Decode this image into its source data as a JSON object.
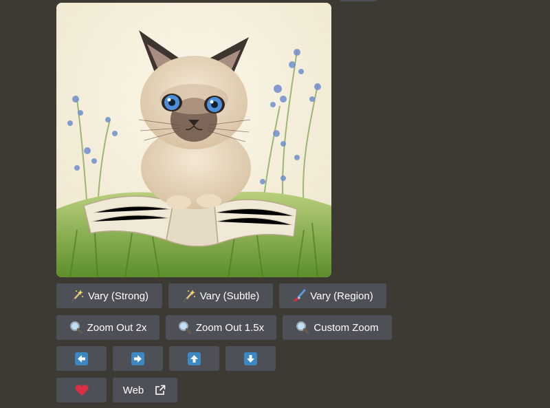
{
  "message": {
    "image_alt": "Watercolor Siamese kitten sitting on an open book in grass with blue flowers"
  },
  "buttons": {
    "row1": [
      {
        "label": "Vary (Strong)",
        "icon": "magic-wand-icon"
      },
      {
        "label": "Vary (Subtle)",
        "icon": "magic-wand-icon"
      },
      {
        "label": "Vary (Region)",
        "icon": "paintbrush-icon"
      }
    ],
    "row2": [
      {
        "label": "Zoom Out 2x",
        "icon": "magnifier-icon"
      },
      {
        "label": "Zoom Out 1.5x",
        "icon": "magnifier-icon"
      },
      {
        "label": "Custom Zoom",
        "icon": "magnifier-icon"
      }
    ],
    "row3": [
      {
        "icon": "arrow-left-icon"
      },
      {
        "icon": "arrow-right-icon"
      },
      {
        "icon": "arrow-up-icon"
      },
      {
        "icon": "arrow-down-icon"
      }
    ],
    "row4": [
      {
        "icon": "heart-icon"
      },
      {
        "label": "Web",
        "icon": "external-link-icon"
      }
    ]
  },
  "colors": {
    "background": "#3c3a33",
    "button_bg": "#4e5058",
    "arrow_blue": "#3b88c3",
    "heart_red": "#dd2e44"
  }
}
